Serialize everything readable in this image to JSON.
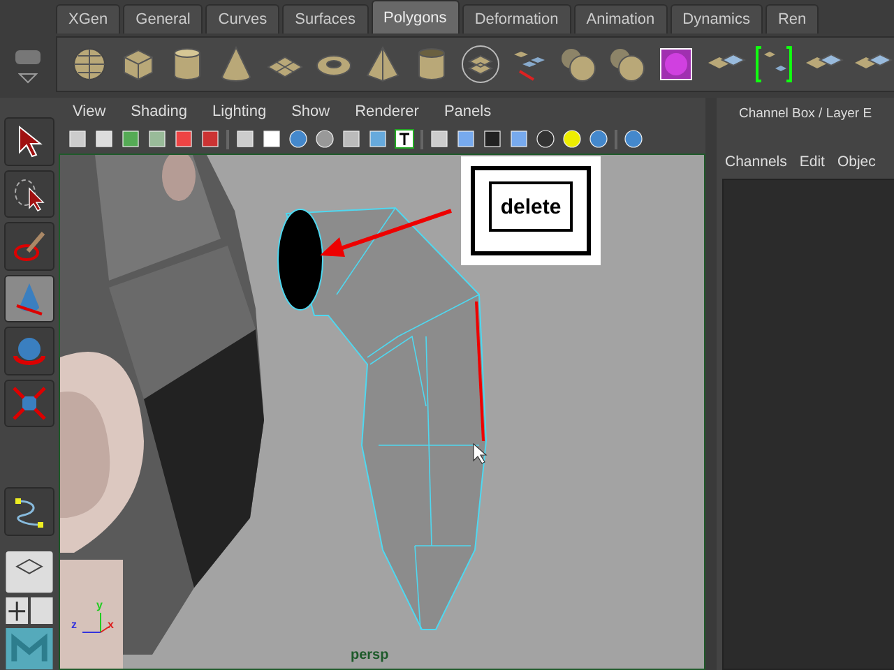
{
  "shelf": {
    "tabs": [
      {
        "label": "XGen",
        "selected": false
      },
      {
        "label": "General",
        "selected": false
      },
      {
        "label": "Curves",
        "selected": false
      },
      {
        "label": "Surfaces",
        "selected": false
      },
      {
        "label": "Polygons",
        "selected": true
      },
      {
        "label": "Deformation",
        "selected": false
      },
      {
        "label": "Animation",
        "selected": false
      },
      {
        "label": "Dynamics",
        "selected": false
      },
      {
        "label": "Ren",
        "selected": false
      }
    ]
  },
  "toolbox": {
    "tools": [
      {
        "kind": "select",
        "selected": false
      },
      {
        "kind": "lasso",
        "selected": false
      },
      {
        "kind": "paint",
        "selected": false
      },
      {
        "kind": "move",
        "selected": true
      },
      {
        "kind": "rotate",
        "selected": false
      },
      {
        "kind": "scale",
        "selected": false
      }
    ],
    "last_tool": {
      "kind": "curve"
    }
  },
  "viewport": {
    "menus": [
      "View",
      "Shading",
      "Lighting",
      "Show",
      "Renderer",
      "Panels"
    ],
    "callout": {
      "key_label": "delete"
    },
    "axis": {
      "y": "y",
      "z": "z",
      "x": "x"
    },
    "camera_label": "persp"
  },
  "channel_box": {
    "title": "Channel Box / Layer E",
    "menus": [
      "Channels",
      "Edit",
      "Objec"
    ]
  }
}
